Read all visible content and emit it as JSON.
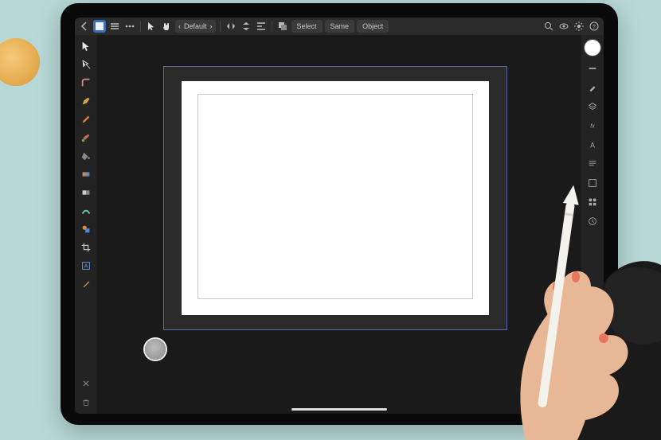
{
  "toolbar": {
    "preset_prev": "‹",
    "preset_label": "Default",
    "preset_next": "›",
    "select_label": "Select",
    "same_label": "Same",
    "object_label": "Object"
  },
  "left_tools": [
    {
      "name": "move-tool",
      "active": false
    },
    {
      "name": "node-tool",
      "active": false
    },
    {
      "name": "corner-tool",
      "active": false
    },
    {
      "name": "pen-tool",
      "active": false
    },
    {
      "name": "pencil-tool",
      "active": false
    },
    {
      "name": "brush-tool",
      "active": false
    },
    {
      "name": "fill-tool",
      "active": false
    },
    {
      "name": "gradient-tool",
      "active": false
    },
    {
      "name": "transparency-tool",
      "active": false
    },
    {
      "name": "shape-tool",
      "active": false
    },
    {
      "name": "crop-tool",
      "active": false
    },
    {
      "name": "text-tool",
      "active": false
    },
    {
      "name": "color-picker-tool",
      "active": false
    }
  ],
  "right_panels": [
    {
      "name": "color-swatch"
    },
    {
      "name": "stroke-panel"
    },
    {
      "name": "brushes-panel"
    },
    {
      "name": "layers-panel"
    },
    {
      "name": "effects-panel"
    },
    {
      "name": "text-panel"
    },
    {
      "name": "paragraph-panel"
    },
    {
      "name": "styles-panel"
    },
    {
      "name": "assets-panel"
    },
    {
      "name": "history-panel"
    }
  ],
  "colors": {
    "accent": "#3a6fb8",
    "canvas_bg": "#1a1a1a",
    "panel_bg": "#232323",
    "artboard_outline": "#5a6aa8"
  }
}
